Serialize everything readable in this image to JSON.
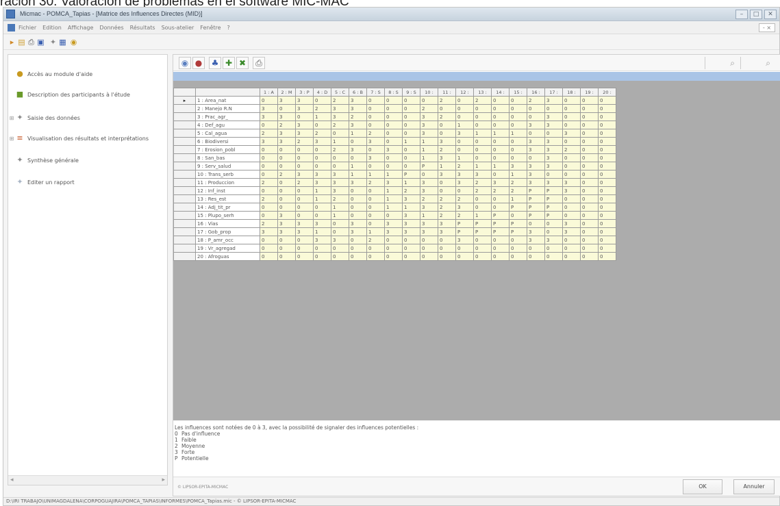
{
  "caption": "ración 30. Valoración de problemas en el software MIC-MAC",
  "window": {
    "title": "Micmac - POMCA_Tapias - [Matrice des Influences Directes (MID)]",
    "controls": [
      "–",
      "□",
      "✕"
    ]
  },
  "menubar": {
    "items": [
      "Fichier",
      "Edition",
      "Affichage",
      "Données",
      "Résultats",
      "Sous-atelier",
      "Fenêtre",
      "?"
    ],
    "mdi_label": "- ×"
  },
  "toolbar": {
    "icons": [
      {
        "name": "new-icon",
        "glyph": "▸",
        "color": "#d08a2a"
      },
      {
        "name": "folder-icon",
        "glyph": "▤",
        "color": "#d0a23a"
      },
      {
        "name": "print-icon",
        "glyph": "⎙",
        "color": "#555555"
      },
      {
        "name": "save-icon",
        "glyph": "▣",
        "color": "#3a5fb0"
      },
      {
        "name": "magic-icon",
        "glyph": "✦",
        "color": "#888888"
      },
      {
        "name": "grid-icon",
        "glyph": "▦",
        "color": "#3a5fb0"
      },
      {
        "name": "help-icon",
        "glyph": "◉",
        "color": "#c89a20"
      }
    ]
  },
  "sidebar": {
    "items": [
      {
        "label": "Accès au module d'aide",
        "icon": "help-icon",
        "glyph": "●",
        "color": "#c89a20",
        "expander": ""
      },
      {
        "label": "Description des participants à l'étude",
        "icon": "participants-icon",
        "glyph": "■",
        "color": "#6a9a2a",
        "expander": ""
      },
      {
        "label": "Saisie des données",
        "icon": "data-entry-icon",
        "glyph": "✦",
        "color": "#888888",
        "expander": "⊞"
      },
      {
        "label": "Visualisation des résultats et interprétations",
        "icon": "chart-icon",
        "glyph": "≡",
        "color": "#c85a2a",
        "expander": "⊞"
      },
      {
        "label": "Synthèse générale",
        "icon": "synthesis-icon",
        "glyph": "✦",
        "color": "#888888",
        "expander": ""
      },
      {
        "label": "Editer un rapport",
        "icon": "report-icon",
        "glyph": "✦",
        "color": "#aab6c6",
        "expander": ""
      }
    ]
  },
  "matrix": {
    "columns": [
      "1 : A",
      "2 : M",
      "3 : P",
      "4 : D",
      "5 : C",
      "6 : B",
      "7 : S",
      "8 : S",
      "9 : S",
      "10 :",
      "11 :",
      "12 :",
      "13 :",
      "14 :",
      "15 :",
      "16 :",
      "17 :",
      "18 :",
      "19 :",
      "20 :"
    ],
    "row_labels": [
      "1 : Area_nat",
      "2 : Manejo R.N",
      "3 : Prac_agr_",
      "4 : Def_agu",
      "5 : Cal_agua",
      "6 : Biodiversi",
      "7 : Erosion_pobl",
      "8 : San_bas",
      "9 : Serv_salud",
      "10 : Trans_serb",
      "11 : Produccion",
      "12 : Inf_inst",
      "13 : Res_est",
      "14 : Adj_tit_pr",
      "15 : Plupo_serh",
      "16 : Vias",
      "17 : Gob_prop",
      "18 : P_amr_occ",
      "19 : Vr_agregad",
      "20 : Afroguas"
    ],
    "rows": [
      [
        "0",
        "3",
        "3",
        "0",
        "2",
        "3",
        "0",
        "0",
        "0",
        "0",
        "2",
        "0",
        "2",
        "0",
        "0",
        "2",
        "3",
        "0",
        "0",
        "0"
      ],
      [
        "3",
        "0",
        "3",
        "2",
        "3",
        "3",
        "0",
        "0",
        "0",
        "2",
        "0",
        "0",
        "0",
        "0",
        "0",
        "0",
        "0",
        "0",
        "0",
        "0"
      ],
      [
        "3",
        "3",
        "0",
        "1",
        "3",
        "2",
        "0",
        "0",
        "0",
        "3",
        "2",
        "0",
        "0",
        "0",
        "0",
        "0",
        "3",
        "0",
        "0",
        "0"
      ],
      [
        "0",
        "2",
        "3",
        "0",
        "2",
        "3",
        "0",
        "0",
        "0",
        "3",
        "0",
        "1",
        "0",
        "0",
        "0",
        "3",
        "3",
        "0",
        "0",
        "0"
      ],
      [
        "2",
        "3",
        "3",
        "2",
        "0",
        "1",
        "2",
        "0",
        "0",
        "3",
        "0",
        "3",
        "1",
        "1",
        "1",
        "0",
        "0",
        "3",
        "0",
        "0"
      ],
      [
        "3",
        "3",
        "2",
        "3",
        "1",
        "0",
        "3",
        "0",
        "1",
        "1",
        "3",
        "0",
        "0",
        "0",
        "0",
        "3",
        "3",
        "0",
        "0",
        "0"
      ],
      [
        "0",
        "0",
        "0",
        "0",
        "2",
        "3",
        "0",
        "3",
        "0",
        "1",
        "2",
        "0",
        "0",
        "0",
        "0",
        "3",
        "3",
        "2",
        "0",
        "0"
      ],
      [
        "0",
        "0",
        "0",
        "0",
        "0",
        "0",
        "3",
        "0",
        "0",
        "1",
        "3",
        "1",
        "0",
        "0",
        "0",
        "0",
        "3",
        "0",
        "0",
        "0"
      ],
      [
        "0",
        "0",
        "0",
        "0",
        "0",
        "1",
        "0",
        "0",
        "0",
        "P",
        "1",
        "2",
        "1",
        "1",
        "3",
        "3",
        "3",
        "0",
        "0",
        "0"
      ],
      [
        "0",
        "2",
        "3",
        "3",
        "3",
        "1",
        "1",
        "1",
        "P",
        "0",
        "3",
        "3",
        "3",
        "0",
        "1",
        "3",
        "0",
        "0",
        "0",
        "0"
      ],
      [
        "2",
        "0",
        "2",
        "3",
        "3",
        "3",
        "2",
        "3",
        "1",
        "3",
        "0",
        "3",
        "2",
        "3",
        "2",
        "3",
        "3",
        "3",
        "0",
        "0"
      ],
      [
        "0",
        "0",
        "0",
        "1",
        "3",
        "0",
        "0",
        "1",
        "2",
        "3",
        "0",
        "0",
        "2",
        "2",
        "2",
        "P",
        "P",
        "3",
        "0",
        "0"
      ],
      [
        "2",
        "0",
        "0",
        "1",
        "2",
        "0",
        "0",
        "1",
        "3",
        "2",
        "2",
        "2",
        "0",
        "0",
        "1",
        "P",
        "P",
        "0",
        "0",
        "0"
      ],
      [
        "0",
        "0",
        "0",
        "0",
        "1",
        "0",
        "0",
        "1",
        "1",
        "3",
        "2",
        "3",
        "0",
        "0",
        "P",
        "P",
        "P",
        "0",
        "0",
        "0"
      ],
      [
        "0",
        "3",
        "0",
        "0",
        "1",
        "0",
        "0",
        "0",
        "3",
        "1",
        "2",
        "2",
        "1",
        "P",
        "0",
        "P",
        "P",
        "0",
        "0",
        "0"
      ],
      [
        "2",
        "3",
        "3",
        "3",
        "0",
        "3",
        "0",
        "3",
        "3",
        "3",
        "3",
        "P",
        "P",
        "P",
        "P",
        "0",
        "0",
        "3",
        "0",
        "0"
      ],
      [
        "3",
        "3",
        "3",
        "1",
        "0",
        "3",
        "1",
        "3",
        "3",
        "3",
        "3",
        "P",
        "P",
        "P",
        "P",
        "3",
        "0",
        "3",
        "0",
        "0"
      ],
      [
        "0",
        "0",
        "0",
        "3",
        "3",
        "0",
        "2",
        "0",
        "0",
        "0",
        "0",
        "3",
        "0",
        "0",
        "0",
        "3",
        "3",
        "0",
        "0",
        "0"
      ],
      [
        "0",
        "0",
        "0",
        "0",
        "0",
        "0",
        "0",
        "0",
        "0",
        "0",
        "0",
        "0",
        "0",
        "0",
        "0",
        "0",
        "0",
        "0",
        "0",
        "0"
      ],
      [
        "0",
        "0",
        "0",
        "0",
        "0",
        "0",
        "0",
        "0",
        "0",
        "0",
        "0",
        "0",
        "0",
        "0",
        "0",
        "0",
        "0",
        "0",
        "0",
        "0"
      ]
    ]
  },
  "legend": {
    "note": "Les influences sont notées de 0 à 3, avec la possibilité de signaler des influences potentielles :",
    "items": [
      {
        "code": "0",
        "label": "Pas d'influence"
      },
      {
        "code": "1",
        "label": "Faible"
      },
      {
        "code": "2",
        "label": "Moyenne"
      },
      {
        "code": "3",
        "label": "Forte"
      },
      {
        "code": "P",
        "label": "Potentielle"
      }
    ]
  },
  "footer": {
    "copyright": "© LIPSOR-EPITA-MICMAC",
    "ok_label": "OK",
    "cancel_label": "Annuler"
  },
  "statusbar": {
    "path": "D:\\IRI TRABAJO\\UNIMAGDALENA\\CORPOGUAJIRA\\POMCA_TAPIAS\\INFORMES\\POMCA_Tapias.mic - © LIPSOR-EPITA-MICMAC"
  }
}
